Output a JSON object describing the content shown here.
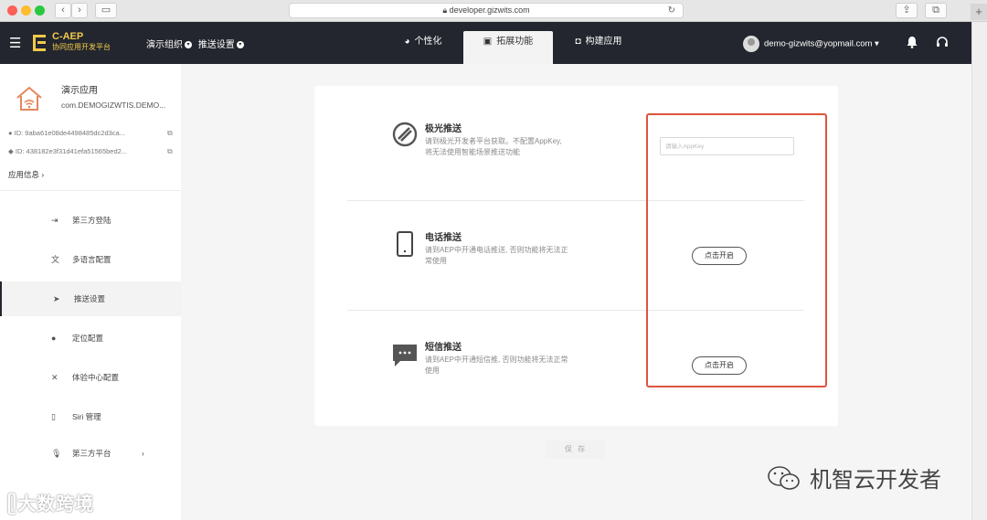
{
  "browser": {
    "url": "developer.gizwits.com"
  },
  "header": {
    "brand_title": "C-AEP",
    "brand_subtitle": "协同应用开发平台",
    "crumb_org": "演示组织",
    "crumb_page": "推送设置",
    "tabs": [
      {
        "label": "个性化",
        "icon": "palette-icon"
      },
      {
        "label": "拓展功能",
        "icon": "extension-icon"
      },
      {
        "label": "构建应用",
        "icon": "build-icon"
      }
    ],
    "user_email": "demo-gizwits@yopmail.com ▾"
  },
  "sidebar": {
    "app_name": "演示应用",
    "app_package": "com.DEMOGIZWTIS.DEMO...",
    "ios_id": "ID:  9aba61e08de4498485dc2d3ca...",
    "android_id": "ID:  438182e3f31d41efa51565bed2...",
    "app_info_label": "应用信息 ›",
    "items": [
      {
        "label": "第三方登陆",
        "icon": "login-icon"
      },
      {
        "label": "多语言配置",
        "icon": "language-icon"
      },
      {
        "label": "推送设置",
        "icon": "send-icon",
        "active": true
      },
      {
        "label": "定位配置",
        "icon": "location-icon"
      },
      {
        "label": "体验中心配置",
        "icon": "magic-wand-icon"
      },
      {
        "label": "Siri 管理",
        "icon": "phone-icon"
      },
      {
        "label": "第三方平台",
        "icon": "mic-icon",
        "chevron": "›"
      }
    ]
  },
  "sections": [
    {
      "title": "极光推送",
      "desc_line1": "请到极光开发者平台获取。不配置AppKey,",
      "desc_line2": "将无法使用智能场景推送功能",
      "input_placeholder": "请输入AppKey"
    },
    {
      "title": "电话推送",
      "desc_line1": "请到AEP中开通电话推送, 否则功能将无法正",
      "desc_line2": "常使用",
      "button": "点击开启"
    },
    {
      "title": "短信推送",
      "desc_line1": "请到AEP中开通短信推, 否则功能将无法正常",
      "desc_line2": "使用",
      "button": "点击开启"
    }
  ],
  "save_label": "保 存",
  "watermark_left": "大数跨境",
  "watermark_right": "机智云开发者",
  "colors": {
    "header_bg": "#23262e",
    "brand": "#f2c94c",
    "highlight": "#e0533e"
  }
}
